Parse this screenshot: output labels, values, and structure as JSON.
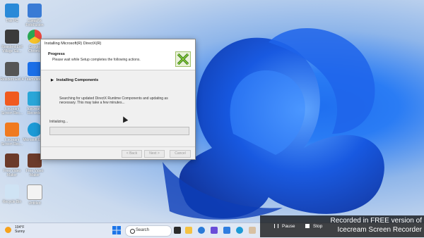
{
  "desktop_icons": [
    {
      "label": "This PC",
      "icon": "pc-icon",
      "color": "#2a8ad8"
    },
    {
      "label": "Resident Evil Village Gu...",
      "icon": "game-icon",
      "color": "#3b3b3b"
    },
    {
      "label": "Resident Evil 4",
      "icon": "game-icon",
      "color": "#3b3b3b"
    },
    {
      "label": "Icecream Screen Rec...",
      "icon": "icecream-screen-recorder-icon",
      "color": "#f05a1f"
    },
    {
      "label": "Icecream Screen Rec...",
      "icon": "icecream-screen-recorder-icon",
      "color": "#f07a1f"
    },
    {
      "label": "Free Video Maker",
      "icon": "video-maker-icon",
      "color": "#6b3a2a"
    },
    {
      "label": "Recycle Bin",
      "icon": "recycle-bin-icon",
      "color": "#cfe3f4"
    },
    {
      "label": "LumaPix FotoFusion",
      "icon": "app-icon",
      "color": "#3a7bd5"
    },
    {
      "label": "Google Chrome",
      "icon": "chrome-icon",
      "color": "#e8473d"
    },
    {
      "label": "TeamViewer",
      "icon": "teamviewer-icon",
      "color": "#1a6fe8"
    },
    {
      "label": "Icecream Recorder",
      "icon": "icecream-icon",
      "color": "#2aa6d8"
    },
    {
      "label": "Microsoft Edge",
      "icon": "edge-icon",
      "color": "#1c9ad6"
    },
    {
      "label": "Free Video Maker",
      "icon": "video-maker-icon",
      "color": "#6b3a2a"
    },
    {
      "label": "Untitled",
      "icon": "file-icon",
      "color": "#f3f3f3"
    }
  ],
  "dialog": {
    "title": "Installing Microsoft(R) DirectX(R)",
    "heading": "Progress",
    "subheading": "Please wait while Setup completes the following actions.",
    "section": "Installing Components",
    "description": "Searching for updated DirectX Runtime Components and updating as necessary. This may take a few minutes...",
    "status": "Initializing...",
    "progress": 0,
    "buttons": {
      "back": "< Back",
      "next": "Next >",
      "cancel": "Cancel"
    }
  },
  "taskbar": {
    "weather_temp": "104°F",
    "weather_desc": "Sunny",
    "search_label": "Search"
  },
  "recorder": {
    "pause": "Pause",
    "stop": "Stop",
    "watermark_line1": "Recorded in FREE version of",
    "watermark_line2": "Icecream Screen Recorder"
  },
  "colors": {
    "wallpaper_accent": "#1f6ff0",
    "progress_fill": "#06b025",
    "taskbar": "#e1e8f4"
  }
}
